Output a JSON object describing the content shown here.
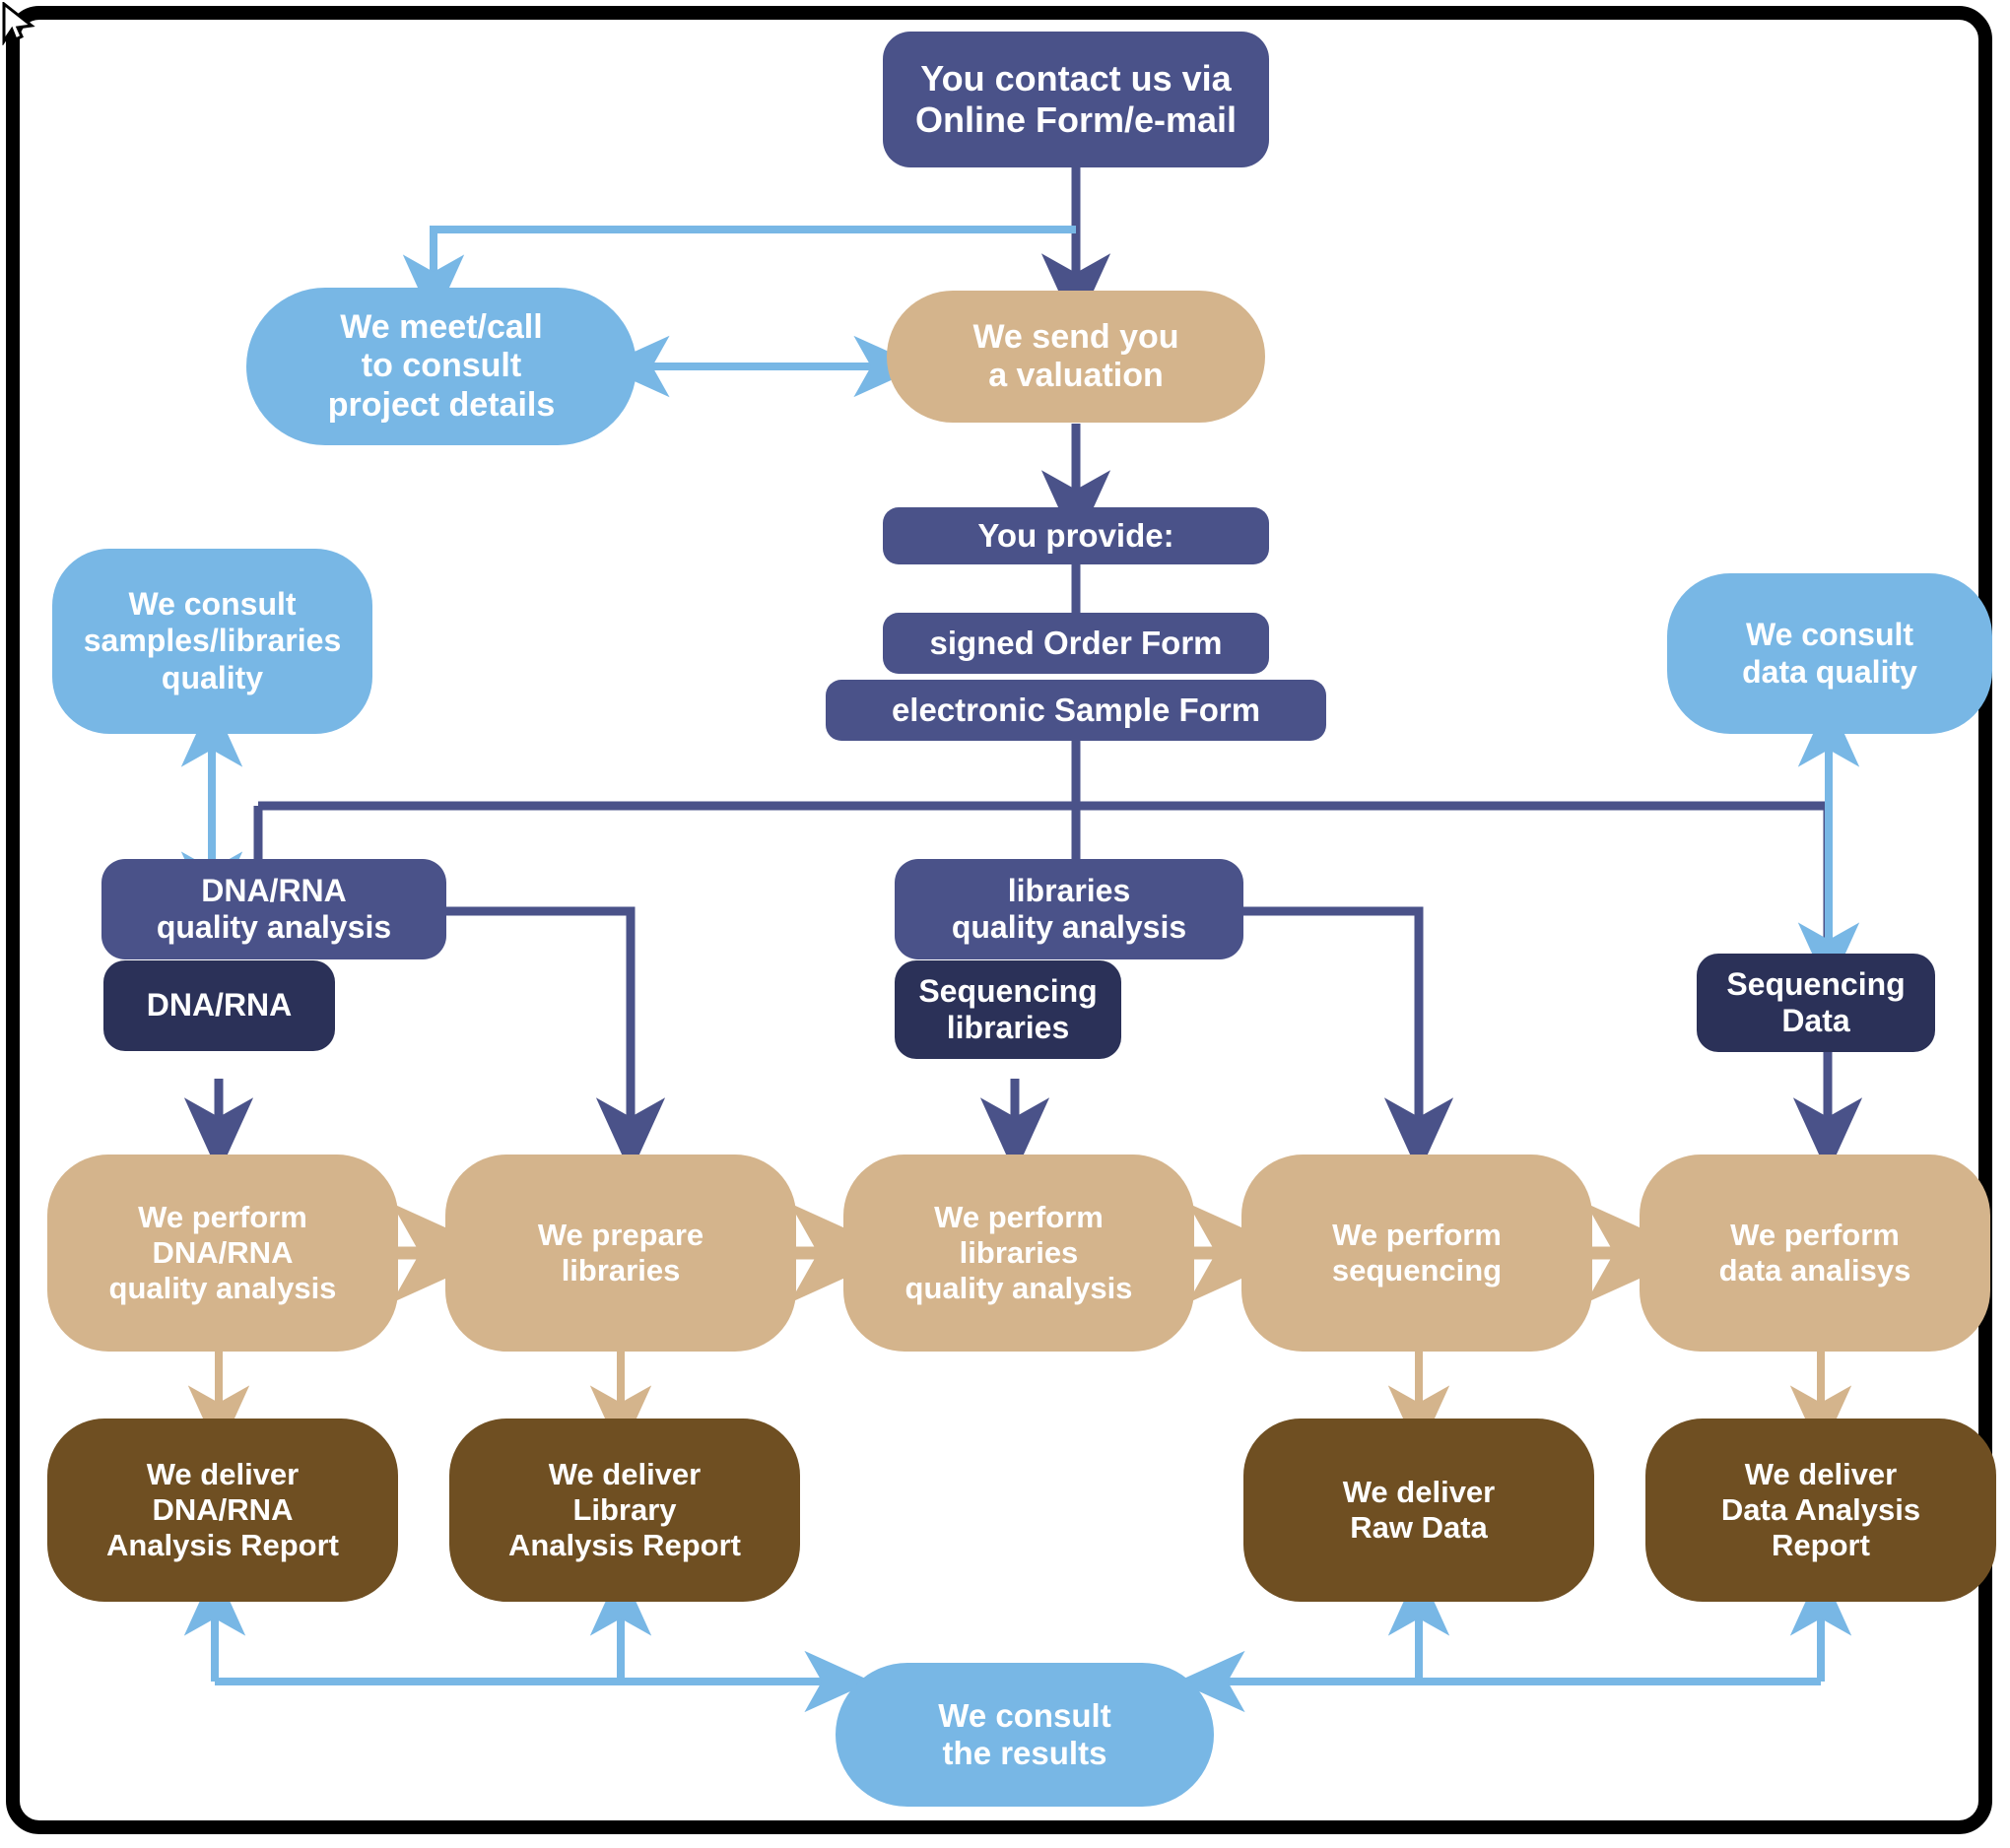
{
  "diagram": {
    "title": "Sequencing service workflow",
    "colors": {
      "dark_blue": "#4a5289",
      "navy": "#2b3158",
      "light_blue": "#78b7e5",
      "tan": "#d4b48c",
      "brown": "#6f4f22",
      "frame": "#000000",
      "background": "#ffffff"
    },
    "nodes": {
      "contact": "You contact us via\nOnline Form/e-mail",
      "meet_call": "We meet/call\nto consult\nproject details",
      "valuation": "We send you\na valuation",
      "you_provide": "You provide:",
      "order_form": "signed Order Form",
      "sample_form": "electronic Sample Form",
      "consult_samples": "We consult\nsamples/libraries\nquality",
      "consult_data_quality": "We consult\ndata quality",
      "dna_rna_qa": "DNA/RNA\nquality analysis",
      "dna_rna": "DNA/RNA",
      "libraries_qa": "libraries\nquality analysis",
      "sequencing_libraries": "Sequencing\nlibraries",
      "sequencing_data": "Sequencing\nData",
      "perform_dna_qa": "We perform\nDNA/RNA\nquality analysis",
      "prepare_libraries": "We prepare\nlibraries",
      "perform_lib_qa": "We perform\nlibraries\nquality analysis",
      "perform_sequencing": "We perform\nsequencing",
      "perform_data_analysis": "We perform\ndata analisys",
      "deliver_dna_report": "We deliver\nDNA/RNA\nAnalysis Report",
      "deliver_library_report": "We deliver\nLibrary\nAnalysis Report",
      "deliver_raw_data": "We deliver\nRaw Data",
      "deliver_data_report": "We deliver\nData Analysis\nReport",
      "consult_results": "We consult\nthe results"
    }
  },
  "chart_data": {
    "type": "diagram",
    "title": "Sequencing service workflow",
    "flow_stages": [
      "You contact us via Online Form/e-mail",
      "We send you a valuation",
      "You provide: signed Order Form, electronic Sample Form",
      "DNA/RNA quality analysis / libraries quality analysis / Sequencing Data",
      "We perform DNA/RNA quality analysis -> We prepare libraries -> We perform libraries quality analysis -> We perform sequencing -> We perform data analisys",
      "We deliver DNA/RNA Analysis Report, Library Analysis Report, Raw Data, Data Analysis Report",
      "We consult the results"
    ]
  }
}
